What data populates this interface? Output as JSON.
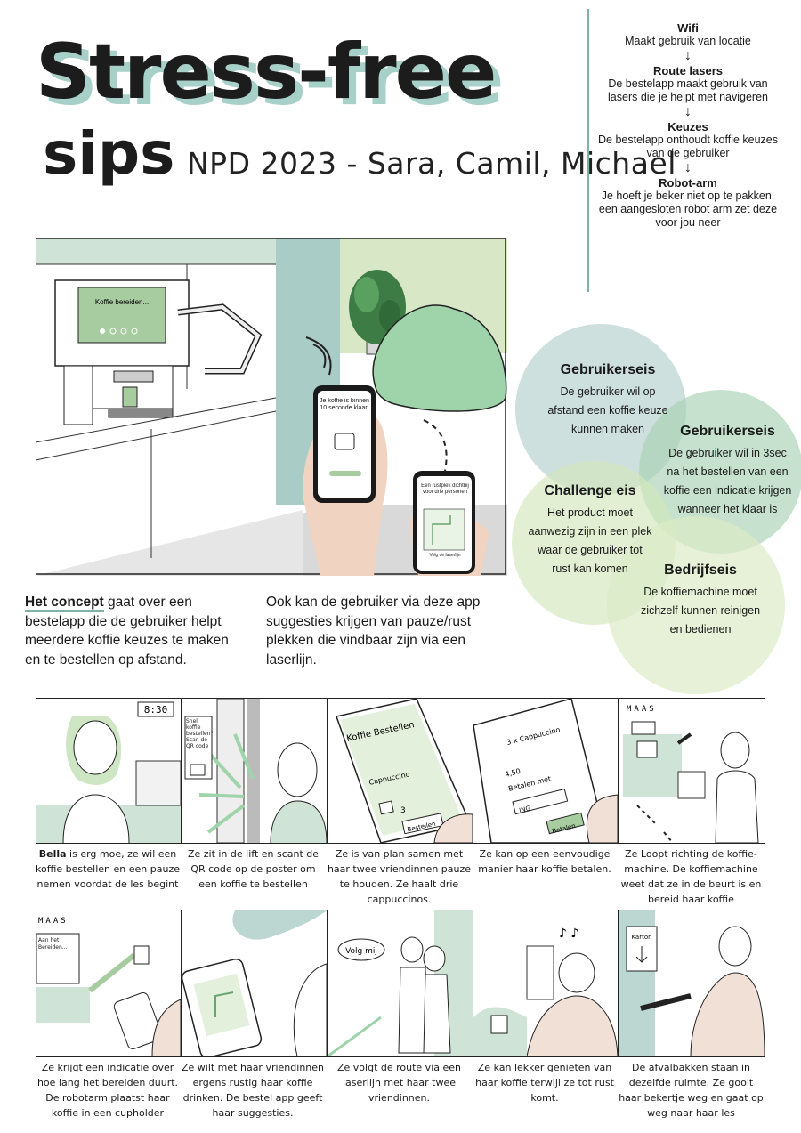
{
  "header": {
    "title": "Stress-free",
    "title2": "sips",
    "subtitle": "NPD 2023 - Sara, Camil, Michael"
  },
  "flow": [
    {
      "heading": "Wifi",
      "text": "Maakt gebruik van locatie"
    },
    {
      "heading": "Route lasers",
      "text": "De bestelapp maakt gebruik van lasers die je helpt met navigeren"
    },
    {
      "heading": "Keuzes",
      "text": "De bestelapp onthoudt koffie keuzes van de gebruiker"
    },
    {
      "heading": "Robot-arm",
      "text": "Je hoeft je beker niet op te pakken, een aangesloten robot arm zet deze voor jou neer"
    }
  ],
  "scene": {
    "screen_text": "Koffie bereiden...",
    "phone_text": "Je koffie is binnen 10 seconde klaar!",
    "phone2_text": "Een rustplek dichtbij voor drie personen",
    "phone2_footer": "Volg de laserlijn"
  },
  "concept": {
    "highlight": "Het concept",
    "text": " gaat over een bestelapp die de gebruiker helpt meerdere koffie keuzes te maken en te bestellen op afstand.",
    "text2": "Ook kan de gebruiker via deze app suggesties krijgen van pauze/rust plekken die vindbaar zijn via een laserlijn."
  },
  "requirements": [
    {
      "title": "Gebruikerseis",
      "text": "De gebruiker wil op afstand een koffie keuze kunnen maken"
    },
    {
      "title": "Gebruikerseis",
      "text": "De gebruiker wil in 3sec na het bestellen van een koffie een indicatie krijgen wanneer het klaar is"
    },
    {
      "title": "Challenge eis",
      "text": "Het product moet aanwezig zijn in een plek waar de gebruiker tot rust kan komen"
    },
    {
      "title": "Bedrijfseis",
      "text": "De koffiemachine moet zichzelf kunnen reinigen en bedienen"
    }
  ],
  "storyboard": {
    "row1": [
      {
        "name": "Bella",
        "caption": " is erg moe, ze wil een koffie bestellen en een pauze nemen voordat de les begint",
        "label": "8:30"
      },
      {
        "caption": "Ze zit in de lift en scant de QR code op de poster om een koffie te bestellen",
        "label": "Snel koffie bestellen? Scan de QR code"
      },
      {
        "caption": "Ze is van plan samen met haar twee vriendinnen pauze te houden. Ze haalt drie cappuccinos.",
        "label": "Koffie Bestellen",
        "sub": "Cappuccino",
        "btn": "Bestellen",
        "qty": "3"
      },
      {
        "caption": "Ze kan op een eenvoudige manier haar koffie betalen.",
        "label": "3 x Cappuccino",
        "sub": "4,50",
        "pay": "Betalen met",
        "bank": "ING",
        "btn": "Betalen"
      },
      {
        "caption": "Ze Loopt richting de koffie-machine. De koffiemachine weet dat ze in de beurt is en bereid haar koffie",
        "label": "MAAS"
      }
    ],
    "row2": [
      {
        "caption": "Ze krijgt een indicatie over hoe lang het bereiden duurt. De robotarm plaatst haar koffie in een cupholder",
        "label": "MAAS",
        "screen": "Aan het Bereiden..."
      },
      {
        "caption": "Ze wilt met haar vriendinnen ergens rustig haar koffie drinken. De bestel app geeft haar suggesties."
      },
      {
        "caption": "Ze volgt de route via een laserlijn met haar twee vriendinnen.",
        "bubble": "Volg mij"
      },
      {
        "caption": "Ze kan lekker genieten van haar koffie terwijl ze tot rust komt."
      },
      {
        "caption": "De afvalbakken staan in dezelfde ruimte. Ze gooit haar bekertje weg en gaat op weg naar haar les",
        "label": "Karton"
      }
    ]
  }
}
